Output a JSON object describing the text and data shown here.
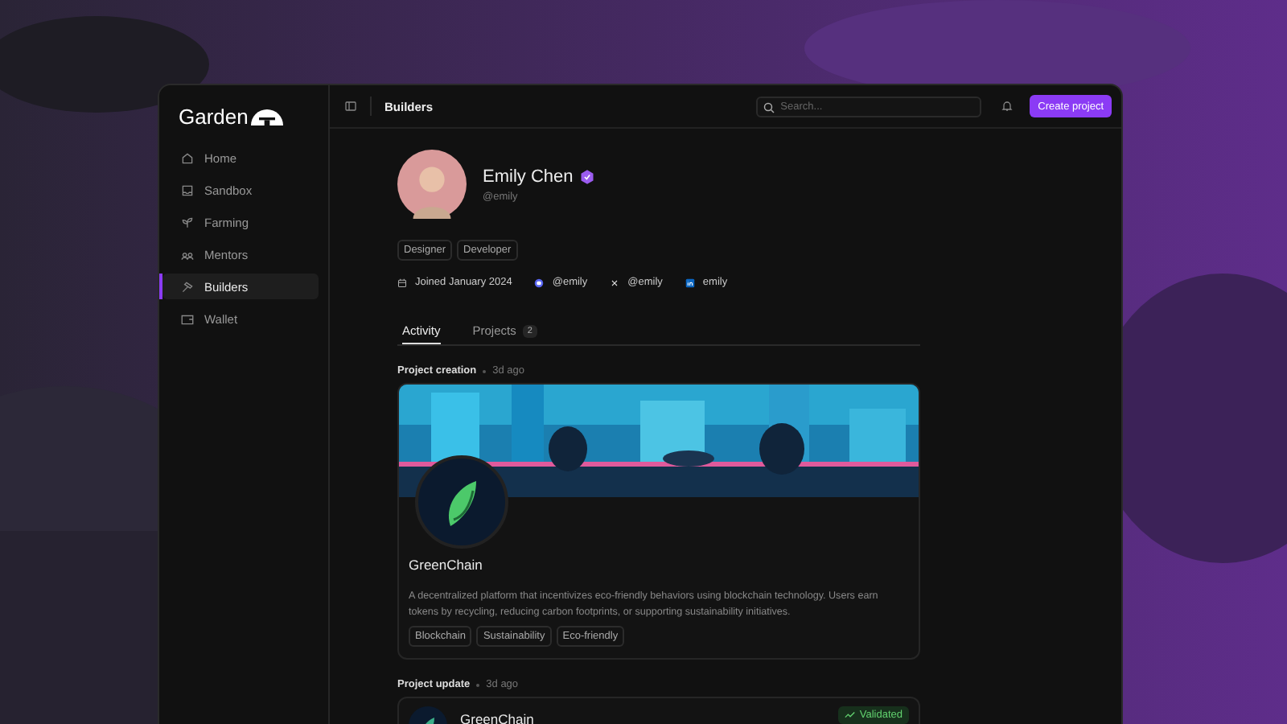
{
  "brand": {
    "name": "Garden"
  },
  "sidebar": {
    "items": [
      {
        "label": "Home",
        "selected": false
      },
      {
        "label": "Sandbox",
        "selected": false
      },
      {
        "label": "Farming",
        "selected": false
      },
      {
        "label": "Mentors",
        "selected": false
      },
      {
        "label": "Builders",
        "selected": true
      },
      {
        "label": "Wallet",
        "selected": false
      }
    ]
  },
  "header": {
    "title": "Builders",
    "search": {
      "placeholder": "Search..."
    },
    "action": "Create project"
  },
  "profile": {
    "name": "Emily Chen",
    "verified": true,
    "handle": "@emily",
    "roles": [
      "Designer",
      "Developer"
    ],
    "meta": [
      {
        "kind": "joined",
        "text": "Joined January 2024"
      },
      {
        "kind": "discord",
        "text": "@emily"
      },
      {
        "kind": "x",
        "text": "@emily"
      },
      {
        "kind": "linkedin",
        "text": "emily"
      }
    ]
  },
  "tabs": [
    {
      "label": "Activity",
      "selected": true
    },
    {
      "label": "Projects",
      "count": "2",
      "selected": false
    }
  ],
  "activity": [
    {
      "kind": "creation",
      "label": "Project creation",
      "time": "3d ago",
      "project": {
        "name": "GreenChain",
        "description": "A decentralized platform that incentivizes eco-friendly behaviors using blockchain technology. Users earn tokens by recycling, reducing carbon footprints, or supporting sustainability initiatives.",
        "tags": [
          "Blockchain",
          "Sustainability",
          "Eco-friendly"
        ]
      }
    },
    {
      "kind": "update",
      "label": "Project update",
      "time": "3d ago",
      "project": {
        "name": "GreenChain"
      },
      "status": "Validated"
    }
  ]
}
